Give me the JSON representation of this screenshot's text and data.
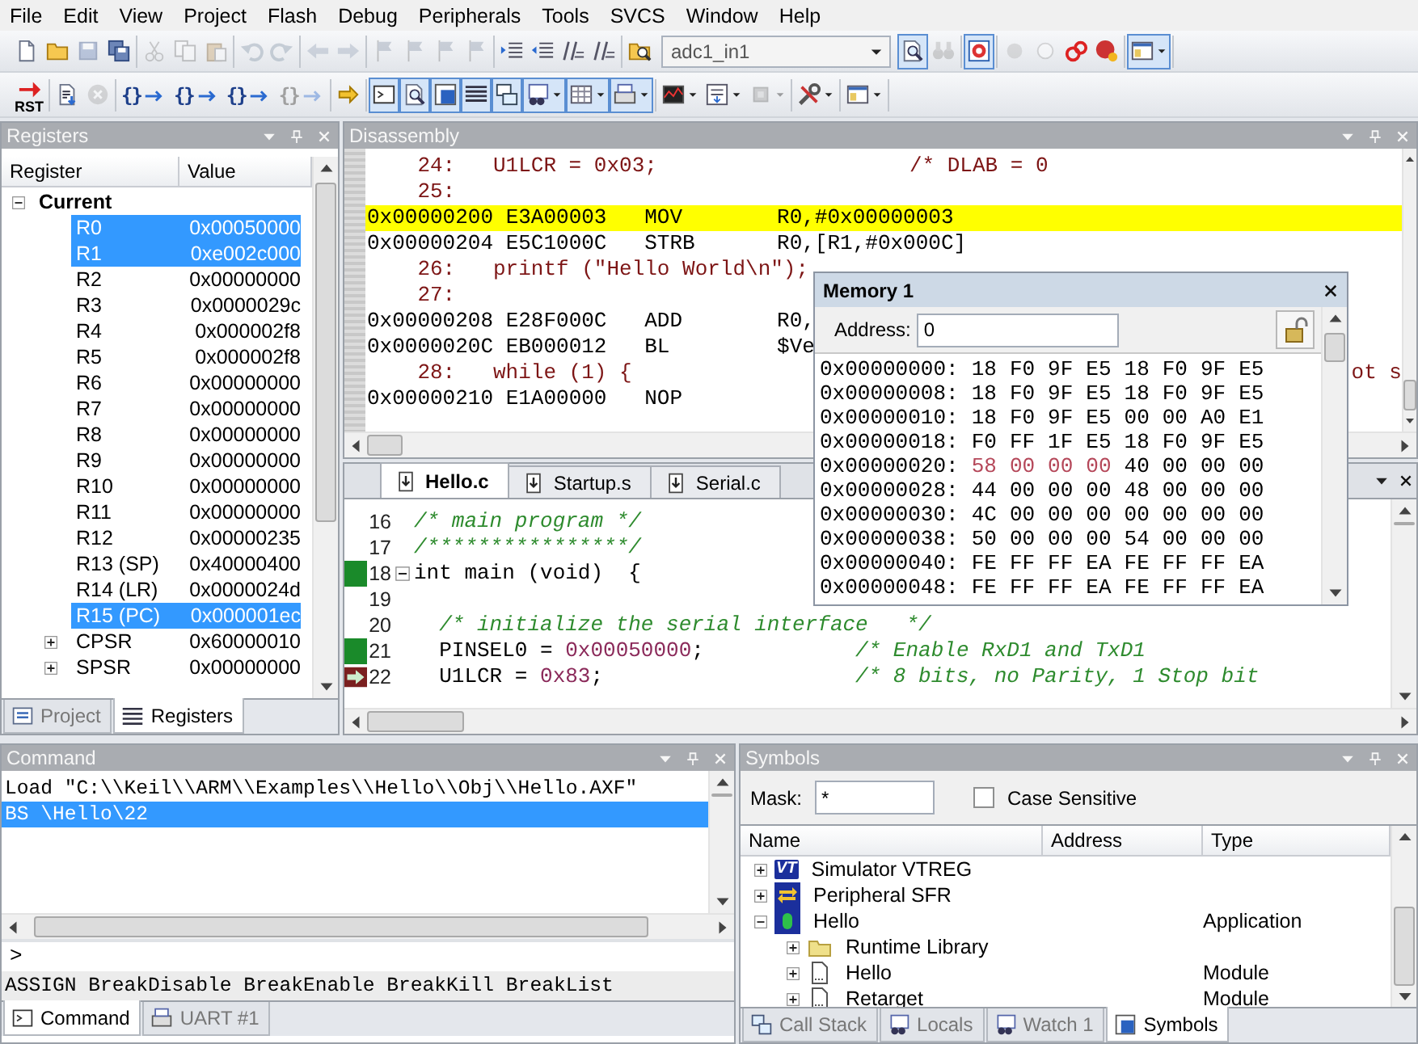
{
  "menu": [
    "File",
    "Edit",
    "View",
    "Project",
    "Flash",
    "Debug",
    "Peripherals",
    "Tools",
    "SVCS",
    "Window",
    "Help"
  ],
  "toolbar_1": {
    "groups": [
      [
        {
          "kind": "button",
          "on": false,
          "disabled": false,
          "dropdown": false
        },
        {
          "kind": "button",
          "on": false,
          "disabled": false,
          "dropdown": false
        },
        {
          "kind": "button",
          "on": false,
          "disabled": true,
          "dropdown": false
        },
        {
          "kind": "button",
          "on": false,
          "disabled": false,
          "dropdown": false
        }
      ],
      [
        {
          "kind": "button",
          "on": false,
          "disabled": true,
          "dropdown": false
        },
        {
          "kind": "button",
          "on": false,
          "disabled": true,
          "dropdown": false
        },
        {
          "kind": "button",
          "on": false,
          "disabled": true,
          "dropdown": false
        }
      ],
      [
        {
          "kind": "button",
          "on": false,
          "disabled": true,
          "dropdown": false
        },
        {
          "kind": "button",
          "on": false,
          "disabled": true,
          "dropdown": false
        }
      ],
      [
        {
          "kind": "button",
          "on": false,
          "disabled": true,
          "dropdown": false
        },
        {
          "kind": "button",
          "on": false,
          "disabled": true,
          "dropdown": false
        }
      ],
      [
        {
          "kind": "button",
          "on": false,
          "disabled": true,
          "dropdown": false
        },
        {
          "kind": "button",
          "on": false,
          "disabled": true,
          "dropdown": false
        },
        {
          "kind": "button",
          "on": false,
          "disabled": true,
          "dropdown": false
        },
        {
          "kind": "button",
          "on": false,
          "disabled": true,
          "dropdown": false
        }
      ],
      [
        {
          "kind": "button",
          "on": false,
          "disabled": false,
          "dropdown": false
        },
        {
          "kind": "button",
          "on": false,
          "disabled": false,
          "dropdown": false
        },
        {
          "kind": "button",
          "on": false,
          "disabled": false,
          "dropdown": false
        },
        {
          "kind": "button",
          "on": false,
          "disabled": false,
          "dropdown": false
        }
      ],
      [
        {
          "kind": "button",
          "on": false,
          "disabled": false,
          "dropdown": false
        },
        {
          "kind": "combo",
          "value": "adc1_in1"
        },
        {
          "kind": "button",
          "on": true,
          "disabled": false,
          "dropdown": false
        },
        {
          "kind": "button",
          "on": false,
          "disabled": true,
          "dropdown": false
        }
      ],
      [
        {
          "kind": "button",
          "on": true,
          "disabled": false,
          "dropdown": false
        }
      ],
      [
        {
          "kind": "button",
          "on": false,
          "disabled": true,
          "dropdown": false
        },
        {
          "kind": "button",
          "on": false,
          "disabled": true,
          "dropdown": false
        },
        {
          "kind": "button",
          "on": false,
          "disabled": false,
          "dropdown": false
        },
        {
          "kind": "button",
          "on": false,
          "disabled": false,
          "dropdown": false
        }
      ],
      [
        {
          "kind": "button",
          "on": true,
          "disabled": false,
          "dropdown": true
        }
      ]
    ]
  },
  "toolbar_2": {
    "groups": [
      [
        {
          "kind": "button",
          "label": "RST",
          "on": false,
          "disabled": false,
          "dropdown": false
        }
      ],
      [
        {
          "kind": "button",
          "on": false,
          "disabled": false,
          "dropdown": false
        },
        {
          "kind": "button",
          "on": false,
          "disabled": true,
          "dropdown": false
        }
      ],
      [
        {
          "kind": "button",
          "label": "{}",
          "on": false,
          "disabled": false,
          "dropdown": false
        },
        {
          "kind": "button",
          "label": "{}",
          "on": false,
          "disabled": false,
          "dropdown": false
        },
        {
          "kind": "button",
          "label": "{}",
          "on": false,
          "disabled": false,
          "dropdown": false
        },
        {
          "kind": "button",
          "label": "{}",
          "on": false,
          "disabled": true,
          "dropdown": false
        }
      ],
      [
        {
          "kind": "button",
          "on": false,
          "disabled": false,
          "dropdown": false
        }
      ],
      [
        {
          "kind": "button",
          "on": true,
          "disabled": false,
          "dropdown": false
        },
        {
          "kind": "button",
          "on": true,
          "disabled": false,
          "dropdown": false
        },
        {
          "kind": "button",
          "on": true,
          "disabled": false,
          "dropdown": false
        },
        {
          "kind": "button",
          "on": true,
          "disabled": false,
          "dropdown": false
        },
        {
          "kind": "button",
          "on": true,
          "disabled": false,
          "dropdown": false
        },
        {
          "kind": "button",
          "on": true,
          "disabled": false,
          "dropdown": true
        },
        {
          "kind": "button",
          "on": true,
          "disabled": false,
          "dropdown": true
        },
        {
          "kind": "button",
          "on": true,
          "disabled": false,
          "dropdown": true
        }
      ],
      [
        {
          "kind": "button",
          "on": false,
          "disabled": false,
          "dropdown": true
        },
        {
          "kind": "button",
          "on": false,
          "disabled": false,
          "dropdown": true
        },
        {
          "kind": "button",
          "on": false,
          "disabled": true,
          "dropdown": true
        }
      ],
      [
        {
          "kind": "button",
          "on": false,
          "disabled": false,
          "dropdown": true
        }
      ],
      [
        {
          "kind": "button",
          "on": false,
          "disabled": false,
          "dropdown": true
        }
      ]
    ]
  },
  "registers": {
    "title": "Registers",
    "columns": [
      "Register",
      "Value"
    ],
    "tree": [
      {
        "name": "Current",
        "expanded": true,
        "children": [
          {
            "kind": "register",
            "name": "R0",
            "value": "0x00050000",
            "selected": true
          },
          {
            "kind": "register",
            "name": "R1",
            "value": "0xe002c000",
            "selected": true
          },
          {
            "kind": "register",
            "name": "R2",
            "value": "0x00000000",
            "selected": false
          },
          {
            "kind": "register",
            "name": "R3",
            "value": "0x0000029c",
            "selected": false
          },
          {
            "kind": "register",
            "name": "R4",
            "value": "0x000002f8",
            "selected": false
          },
          {
            "kind": "register",
            "name": "R5",
            "value": "0x000002f8",
            "selected": false
          },
          {
            "kind": "register",
            "name": "R6",
            "value": "0x00000000",
            "selected": false
          },
          {
            "kind": "register",
            "name": "R7",
            "value": "0x00000000",
            "selected": false
          },
          {
            "kind": "register",
            "name": "R8",
            "value": "0x00000000",
            "selected": false
          },
          {
            "kind": "register",
            "name": "R9",
            "value": "0x00000000",
            "selected": false
          },
          {
            "kind": "register",
            "name": "R10",
            "value": "0x00000000",
            "selected": false
          },
          {
            "kind": "register",
            "name": "R11",
            "value": "0x00000000",
            "selected": false
          },
          {
            "kind": "register",
            "name": "R12",
            "value": "0x00000235",
            "selected": false
          },
          {
            "kind": "register",
            "name": "R13 (SP)",
            "value": "0x40000400",
            "selected": false
          },
          {
            "kind": "register",
            "name": "R14 (LR)",
            "value": "0x0000024d",
            "selected": false
          },
          {
            "kind": "register",
            "name": "R15 (PC)",
            "value": "0x000001ec",
            "selected": true
          },
          {
            "kind": "flags",
            "name": "CPSR",
            "value": "0x60000010",
            "selected": false,
            "expanded": false
          },
          {
            "kind": "flags",
            "name": "SPSR",
            "value": "0x00000000",
            "selected": false,
            "expanded": false
          }
        ]
      }
    ],
    "tabs": [
      {
        "label": "Project",
        "selected": false
      },
      {
        "label": "Registers",
        "selected": true
      }
    ]
  },
  "disassembly": {
    "title": "Disassembly",
    "lines": [
      {
        "kind": "source",
        "num": "24:",
        "code": "U1LCR = 0x03;",
        "comment": "/* DLAB = 0",
        "current": false
      },
      {
        "kind": "source",
        "num": "25:",
        "current": false
      },
      {
        "kind": "asm",
        "address": "0x00000200",
        "opcode": "E3A00003",
        "mnemonic": "MOV",
        "operands": "R0,#0x00000003",
        "current": true
      },
      {
        "kind": "asm",
        "address": "0x00000204",
        "opcode": "E5C1000C",
        "mnemonic": "STRB",
        "operands": "R0,[R1,#0x000C]",
        "current": false
      },
      {
        "kind": "source",
        "num": "26:",
        "code": "printf (\"Hello World\\n\");",
        "current": false
      },
      {
        "kind": "source",
        "num": "27:",
        "current": false
      },
      {
        "kind": "asm",
        "address": "0x00000208",
        "opcode": "E28F000C",
        "mnemonic": "ADD",
        "operands": "R0,",
        "current": false
      },
      {
        "kind": "asm",
        "address": "0x0000020C",
        "opcode": "EB000012",
        "mnemonic": "BL",
        "operands": "$Ve",
        "current": false
      },
      {
        "kind": "source",
        "num": "28:",
        "code": "while (1) {",
        "tail": "ot s",
        "current": false
      },
      {
        "kind": "asm",
        "address": "0x00000210",
        "opcode": "E1A00000",
        "mnemonic": "NOP",
        "current": false
      }
    ]
  },
  "editor": {
    "tabs": [
      {
        "label": "Hello.c",
        "selected": true
      },
      {
        "label": "Startup.s",
        "selected": false
      },
      {
        "label": "Serial.c",
        "selected": false
      }
    ],
    "lines": [
      {
        "num": "16",
        "executed": false,
        "current": false,
        "fold": false,
        "code": [
          {
            "t": "/* main program */",
            "kind": "comment"
          }
        ]
      },
      {
        "num": "17",
        "executed": false,
        "current": false,
        "fold": false,
        "code": [
          {
            "t": "/****************/",
            "kind": "comment"
          }
        ]
      },
      {
        "num": "18",
        "executed": true,
        "current": false,
        "fold": true,
        "code": [
          {
            "t": "int main (void)  {",
            "kind": "plain"
          }
        ]
      },
      {
        "num": "19",
        "executed": false,
        "current": false,
        "fold": false
      },
      {
        "num": "20",
        "executed": false,
        "current": false,
        "fold": false,
        "code": [
          {
            "t": "  /* initialize the serial interface   */",
            "kind": "comment"
          }
        ]
      },
      {
        "num": "21",
        "executed": true,
        "current": false,
        "fold": false,
        "code": [
          {
            "t": "  PINSEL0 = ",
            "kind": "plain"
          },
          {
            "t": "0x00050000",
            "kind": "number"
          },
          {
            "t": ";",
            "kind": "plain"
          }
        ],
        "comment": "/* Enable RxD1 and TxD1"
      },
      {
        "num": "22",
        "executed": false,
        "current": true,
        "fold": false,
        "code": [
          {
            "t": "  U1LCR = ",
            "kind": "plain"
          },
          {
            "t": "0x83",
            "kind": "number"
          },
          {
            "t": ";",
            "kind": "plain"
          }
        ],
        "comment": "/* 8 bits, no Parity, 1 Stop bit"
      }
    ]
  },
  "memory": {
    "title": "Memory 1",
    "address_label": "Address:",
    "address": "0",
    "rows": [
      {
        "address": "0x00000000:",
        "bytes": [
          {
            "v": "18",
            "changed": false
          },
          {
            "v": "F0",
            "changed": false
          },
          {
            "v": "9F",
            "changed": false
          },
          {
            "v": "E5",
            "changed": false
          },
          {
            "v": "18",
            "changed": false
          },
          {
            "v": "F0",
            "changed": false
          },
          {
            "v": "9F",
            "changed": false
          },
          {
            "v": "E5",
            "changed": false
          }
        ]
      },
      {
        "address": "0x00000008:",
        "bytes": [
          {
            "v": "18",
            "changed": false
          },
          {
            "v": "F0",
            "changed": false
          },
          {
            "v": "9F",
            "changed": false
          },
          {
            "v": "E5",
            "changed": false
          },
          {
            "v": "18",
            "changed": false
          },
          {
            "v": "F0",
            "changed": false
          },
          {
            "v": "9F",
            "changed": false
          },
          {
            "v": "E5",
            "changed": false
          }
        ]
      },
      {
        "address": "0x00000010:",
        "bytes": [
          {
            "v": "18",
            "changed": false
          },
          {
            "v": "F0",
            "changed": false
          },
          {
            "v": "9F",
            "changed": false
          },
          {
            "v": "E5",
            "changed": false
          },
          {
            "v": "00",
            "changed": false
          },
          {
            "v": "00",
            "changed": false
          },
          {
            "v": "A0",
            "changed": false
          },
          {
            "v": "E1",
            "changed": false
          }
        ]
      },
      {
        "address": "0x00000018:",
        "bytes": [
          {
            "v": "F0",
            "changed": false
          },
          {
            "v": "FF",
            "changed": false
          },
          {
            "v": "1F",
            "changed": false
          },
          {
            "v": "E5",
            "changed": false
          },
          {
            "v": "18",
            "changed": false
          },
          {
            "v": "F0",
            "changed": false
          },
          {
            "v": "9F",
            "changed": false
          },
          {
            "v": "E5",
            "changed": false
          }
        ]
      },
      {
        "address": "0x00000020:",
        "bytes": [
          {
            "v": "58",
            "changed": true
          },
          {
            "v": "00",
            "changed": true
          },
          {
            "v": "00",
            "changed": true
          },
          {
            "v": "00",
            "changed": true
          },
          {
            "v": "40",
            "changed": false
          },
          {
            "v": "00",
            "changed": false
          },
          {
            "v": "00",
            "changed": false
          },
          {
            "v": "00",
            "changed": false
          }
        ]
      },
      {
        "address": "0x00000028:",
        "bytes": [
          {
            "v": "44",
            "changed": false
          },
          {
            "v": "00",
            "changed": false
          },
          {
            "v": "00",
            "changed": false
          },
          {
            "v": "00",
            "changed": false
          },
          {
            "v": "48",
            "changed": false
          },
          {
            "v": "00",
            "changed": false
          },
          {
            "v": "00",
            "changed": false
          },
          {
            "v": "00",
            "changed": false
          }
        ]
      },
      {
        "address": "0x00000030:",
        "bytes": [
          {
            "v": "4C",
            "changed": false
          },
          {
            "v": "00",
            "changed": false
          },
          {
            "v": "00",
            "changed": false
          },
          {
            "v": "00",
            "changed": false
          },
          {
            "v": "00",
            "changed": false
          },
          {
            "v": "00",
            "changed": false
          },
          {
            "v": "00",
            "changed": false
          },
          {
            "v": "00",
            "changed": false
          }
        ]
      },
      {
        "address": "0x00000038:",
        "bytes": [
          {
            "v": "50",
            "changed": false
          },
          {
            "v": "00",
            "changed": false
          },
          {
            "v": "00",
            "changed": false
          },
          {
            "v": "00",
            "changed": false
          },
          {
            "v": "54",
            "changed": false
          },
          {
            "v": "00",
            "changed": false
          },
          {
            "v": "00",
            "changed": false
          },
          {
            "v": "00",
            "changed": false
          }
        ]
      },
      {
        "address": "0x00000040:",
        "bytes": [
          {
            "v": "FE",
            "changed": false
          },
          {
            "v": "FF",
            "changed": false
          },
          {
            "v": "FF",
            "changed": false
          },
          {
            "v": "EA",
            "changed": false
          },
          {
            "v": "FE",
            "changed": false
          },
          {
            "v": "FF",
            "changed": false
          },
          {
            "v": "FF",
            "changed": false
          },
          {
            "v": "EA",
            "changed": false
          }
        ]
      },
      {
        "address": "0x00000048:",
        "bytes": [
          {
            "v": "FE",
            "changed": false
          },
          {
            "v": "FF",
            "changed": false
          },
          {
            "v": "FF",
            "changed": false
          },
          {
            "v": "EA",
            "changed": false
          },
          {
            "v": "FE",
            "changed": false
          },
          {
            "v": "FF",
            "changed": false
          },
          {
            "v": "FF",
            "changed": false
          },
          {
            "v": "EA",
            "changed": false
          }
        ]
      }
    ]
  },
  "command": {
    "title": "Command",
    "lines": [
      {
        "text": "Load \"C:\\\\Keil\\\\ARM\\\\Examples\\\\Hello\\\\Obj\\\\Hello.AXF\"",
        "selected": false
      },
      {
        "text": "BS \\Hello\\22",
        "selected": true
      }
    ],
    "prompt": ">",
    "hint": "ASSIGN BreakDisable BreakEnable BreakKill BreakList",
    "tabs": [
      {
        "label": "Command",
        "selected": true
      },
      {
        "label": "UART #1",
        "selected": false
      }
    ]
  },
  "symbols": {
    "title": "Symbols",
    "mask_label": "Mask:",
    "mask": "*",
    "case_sensitive": {
      "label": "Case Sensitive",
      "checked": false
    },
    "columns": [
      "Name",
      "Address",
      "Type"
    ],
    "tree": [
      {
        "kind": "vtreg",
        "icon_text": "VT",
        "name": "Simulator VTREG",
        "expanded": false
      },
      {
        "kind": "sfr",
        "name": "Peripheral SFR",
        "expanded": false
      },
      {
        "kind": "application",
        "name": "Hello",
        "type": "Application",
        "expanded": true,
        "children": [
          {
            "kind": "folder",
            "name": "Runtime Library",
            "expanded": false
          },
          {
            "kind": "module",
            "name": "Hello",
            "type": "Module",
            "expanded": false
          },
          {
            "kind": "module",
            "name": "Retarget",
            "type": "Module",
            "expanded": false
          }
        ]
      }
    ],
    "tabs": [
      {
        "label": "Call Stack",
        "selected": false
      },
      {
        "label": "Locals",
        "selected": false
      },
      {
        "label": "Watch 1",
        "selected": false
      },
      {
        "label": "Symbols",
        "selected": true
      }
    ]
  }
}
